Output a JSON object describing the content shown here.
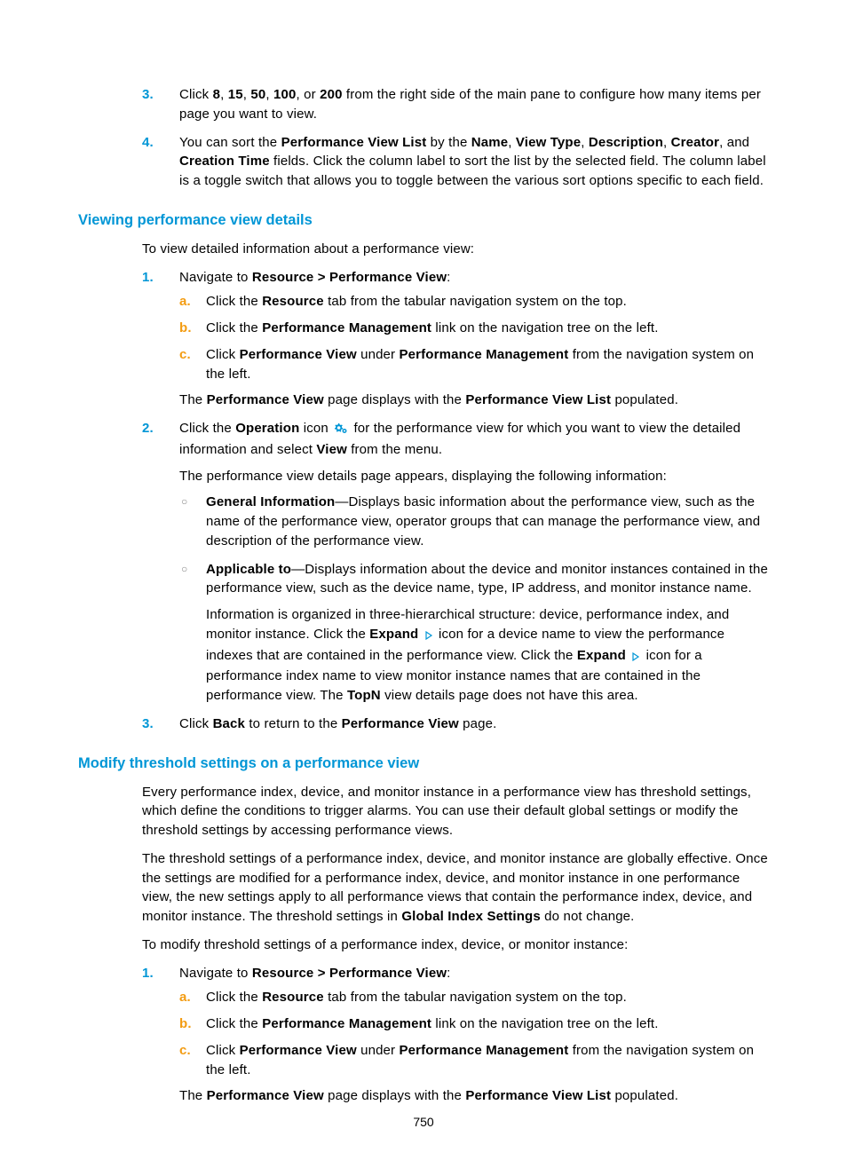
{
  "top_list": {
    "item3": {
      "num": "3.",
      "pre": "Click ",
      "b1": "8",
      "c1": ", ",
      "b2": "15",
      "c2": ", ",
      "b3": "50",
      "c3": ", ",
      "b4": "100",
      "c4": ", or ",
      "b5": "200",
      "post": " from the right side of the main pane to configure how many items per page you want to view."
    },
    "item4": {
      "num": "4.",
      "t1": "You can sort the ",
      "b1": "Performance View List",
      "t2": " by the ",
      "b2": "Name",
      "c2": ", ",
      "b3": "View Type",
      "c3": ", ",
      "b4": "Description",
      "c4": ", ",
      "b5": "Creator",
      "c5": ", and ",
      "b6": "Creation Time",
      "t3": " fields. Click the column label to sort the list by the selected field. The column label is a toggle switch that allows you to toggle between the various sort options specific to each field."
    }
  },
  "sec1": {
    "heading": "Viewing performance view details",
    "intro": "To view detailed information about a performance view:",
    "step1": {
      "num": "1.",
      "t1": "Navigate to ",
      "b1": "Resource > Performance View",
      "t2": ":",
      "a": {
        "m": "a.",
        "t1": "Click the ",
        "b1": "Resource",
        "t2": " tab from the tabular navigation system on the top."
      },
      "b": {
        "m": "b.",
        "t1": "Click the ",
        "b1": "Performance Management",
        "t2": " link on the navigation tree on the left."
      },
      "c": {
        "m": "c.",
        "t1": "Click ",
        "b1": "Performance View",
        "t2": " under ",
        "b2": "Performance Management",
        "t3": " from the navigation system on the left."
      },
      "follow": {
        "t1": "The ",
        "b1": "Performance View",
        "t2": " page displays with the ",
        "b2": "Performance View List",
        "t3": " populated."
      }
    },
    "step2": {
      "num": "2.",
      "t1": "Click the ",
      "b1": "Operation",
      "t2": " icon ",
      "t3": " for the performance view for which you want to view the detailed information and select ",
      "b2": "View",
      "t4": " from the menu.",
      "follow": "The performance view details page appears, displaying the following information:",
      "bul1": {
        "b1": "General Information",
        "t1": "—Displays basic information about the performance view, such as the name of the performance view, operator groups that can manage the performance view, and description of the performance view."
      },
      "bul2": {
        "b1": "Applicable to",
        "t1": "—Displays information about the device and monitor instances contained in the performance view, such as the device name, type, IP address, and monitor instance name.",
        "p2a": "Information is organized in three-hierarchical structure: device, performance index, and monitor instance. Click the ",
        "p2b1": "Expand",
        "p2b": " icon for a device name to view the performance indexes that are contained in the performance view. Click the ",
        "p2b2": "Expand",
        "p2c": " icon for a performance index name to view monitor instance names that are contained in the performance view. The ",
        "p2b3": "TopN",
        "p2d": " view details page does not have this area."
      }
    },
    "step3": {
      "num": "3.",
      "t1": "Click ",
      "b1": "Back",
      "t2": " to return to the ",
      "b2": "Performance View",
      "t3": " page."
    }
  },
  "sec2": {
    "heading": "Modify threshold settings on a performance view",
    "p1": "Every performance index, device, and monitor instance in a performance view has threshold settings, which define the conditions to trigger alarms. You can use their default global settings or modify the threshold settings by accessing performance views.",
    "p2a": "The threshold settings of a performance index, device, and monitor instance are globally effective. Once the settings are modified for a performance index, device, and monitor instance in one performance view, the new settings apply to all performance views that contain the performance index, device, and monitor instance. The threshold settings in ",
    "p2b": "Global Index Settings",
    "p2c": " do not change.",
    "p3": "To modify threshold settings of a performance index, device, or monitor instance:",
    "step1": {
      "num": "1.",
      "t1": "Navigate to ",
      "b1": "Resource > Performance View",
      "t2": ":",
      "a": {
        "m": "a.",
        "t1": "Click the ",
        "b1": "Resource",
        "t2": " tab from the tabular navigation system on the top."
      },
      "b": {
        "m": "b.",
        "t1": "Click the ",
        "b1": "Performance Management",
        "t2": " link on the navigation tree on the left."
      },
      "c": {
        "m": "c.",
        "t1": "Click ",
        "b1": "Performance View",
        "t2": " under ",
        "b2": "Performance Management",
        "t3": " from the navigation system on the left."
      },
      "follow": {
        "t1": "The ",
        "b1": "Performance View",
        "t2": " page displays with the ",
        "b2": "Performance View List",
        "t3": " populated."
      }
    }
  },
  "page_number": "750"
}
